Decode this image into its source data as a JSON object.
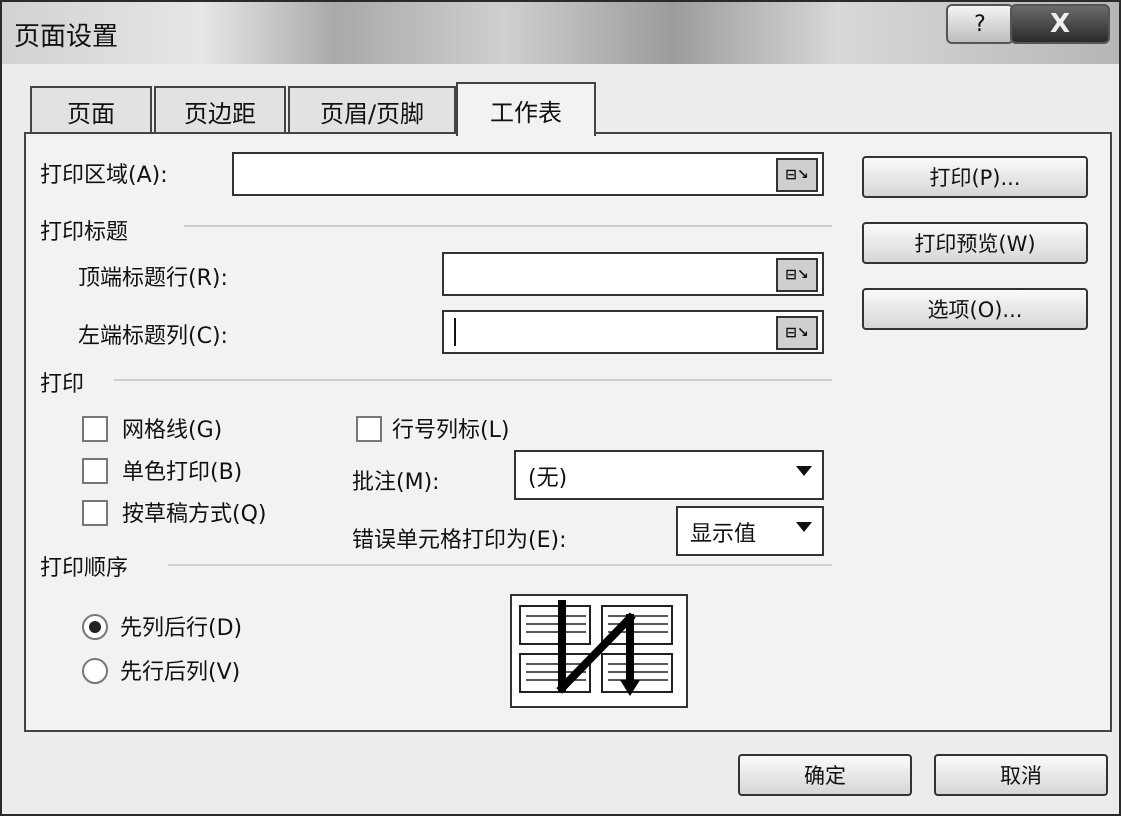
{
  "window": {
    "title": "页面设置",
    "help_label": "?",
    "close_label": "X"
  },
  "tabs": [
    "页面",
    "页边距",
    "页眉/页脚",
    "工作表"
  ],
  "print_area": {
    "label": "打印区域(A):",
    "value": ""
  },
  "print_titles": {
    "heading": "打印标题",
    "top_rows_label": "顶端标题行(R):",
    "left_cols_label": "左端标题列(C):"
  },
  "print_section": {
    "heading": "打印",
    "gridlines": "网格线(G)",
    "row_col_headers": "行号列标(L)",
    "black_white": "单色打印(B)",
    "draft": "按草稿方式(Q)",
    "comments_label": "批注(M):",
    "comments_value": "(无)",
    "errors_label": "错误单元格打印为(E):",
    "errors_value": "显示值"
  },
  "page_order": {
    "heading": "打印顺序",
    "down_then_over": "先列后行(D)",
    "over_then_down": "先行后列(V)",
    "selected": "down_then_over"
  },
  "side_buttons": {
    "print": "打印(P)...",
    "preview": "打印预览(W)",
    "options": "选项(O)..."
  },
  "footer": {
    "ok": "确定",
    "cancel": "取消"
  }
}
